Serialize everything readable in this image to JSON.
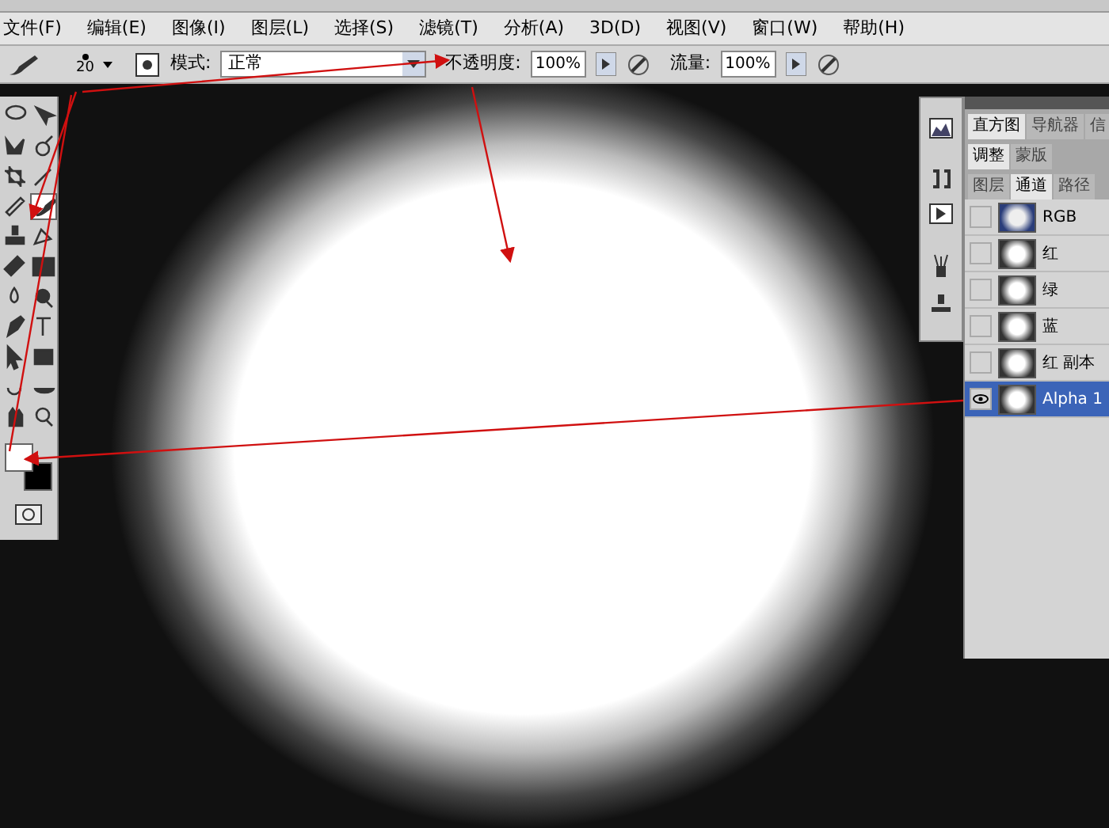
{
  "menu_bar": {
    "items": [
      "文件(F)",
      "编辑(E)",
      "图像(I)",
      "图层(L)",
      "选择(S)",
      "滤镜(T)",
      "分析(A)",
      "3D(D)",
      "视图(V)",
      "窗口(W)",
      "帮助(H)"
    ]
  },
  "options_bar": {
    "brush_size": "20",
    "mode_label": "模式:",
    "mode_value": "正常",
    "opacity_label": "不透明度:",
    "opacity_value": "100%",
    "flow_label": "流量:",
    "flow_value": "100%"
  },
  "tools": [
    {
      "selected": false
    },
    {
      "selected": false
    },
    {
      "selected": false
    },
    {
      "selected": false
    },
    {
      "selected": false
    },
    {
      "selected": false
    },
    {
      "selected": false
    },
    {
      "selected": true
    },
    {
      "selected": false
    },
    {
      "selected": false
    },
    {
      "selected": false
    },
    {
      "selected": false
    },
    {
      "selected": false
    },
    {
      "selected": false
    },
    {
      "selected": false
    },
    {
      "selected": false
    },
    {
      "selected": false
    },
    {
      "selected": false
    },
    {
      "selected": false
    },
    {
      "selected": false
    },
    {
      "selected": false
    },
    {
      "selected": false
    }
  ],
  "panel_tab_rows": [
    [
      {
        "label": "直方图",
        "selected": true
      },
      {
        "label": "导航器",
        "selected": false
      },
      {
        "label": "信",
        "selected": false
      }
    ],
    [
      {
        "label": "调整",
        "selected": true
      },
      {
        "label": "蒙版",
        "selected": false
      }
    ],
    [
      {
        "label": "图层",
        "selected": false
      },
      {
        "label": "通道",
        "selected": true
      },
      {
        "label": "路径",
        "selected": false
      }
    ]
  ],
  "channels": [
    {
      "name": "RGB",
      "visible": false,
      "selected": false
    },
    {
      "name": "红",
      "visible": false,
      "selected": false
    },
    {
      "name": "绿",
      "visible": false,
      "selected": false
    },
    {
      "name": "蓝",
      "visible": false,
      "selected": false
    },
    {
      "name": "红 副本",
      "visible": false,
      "selected": false
    },
    {
      "name": "Alpha 1",
      "visible": true,
      "selected": true
    }
  ]
}
